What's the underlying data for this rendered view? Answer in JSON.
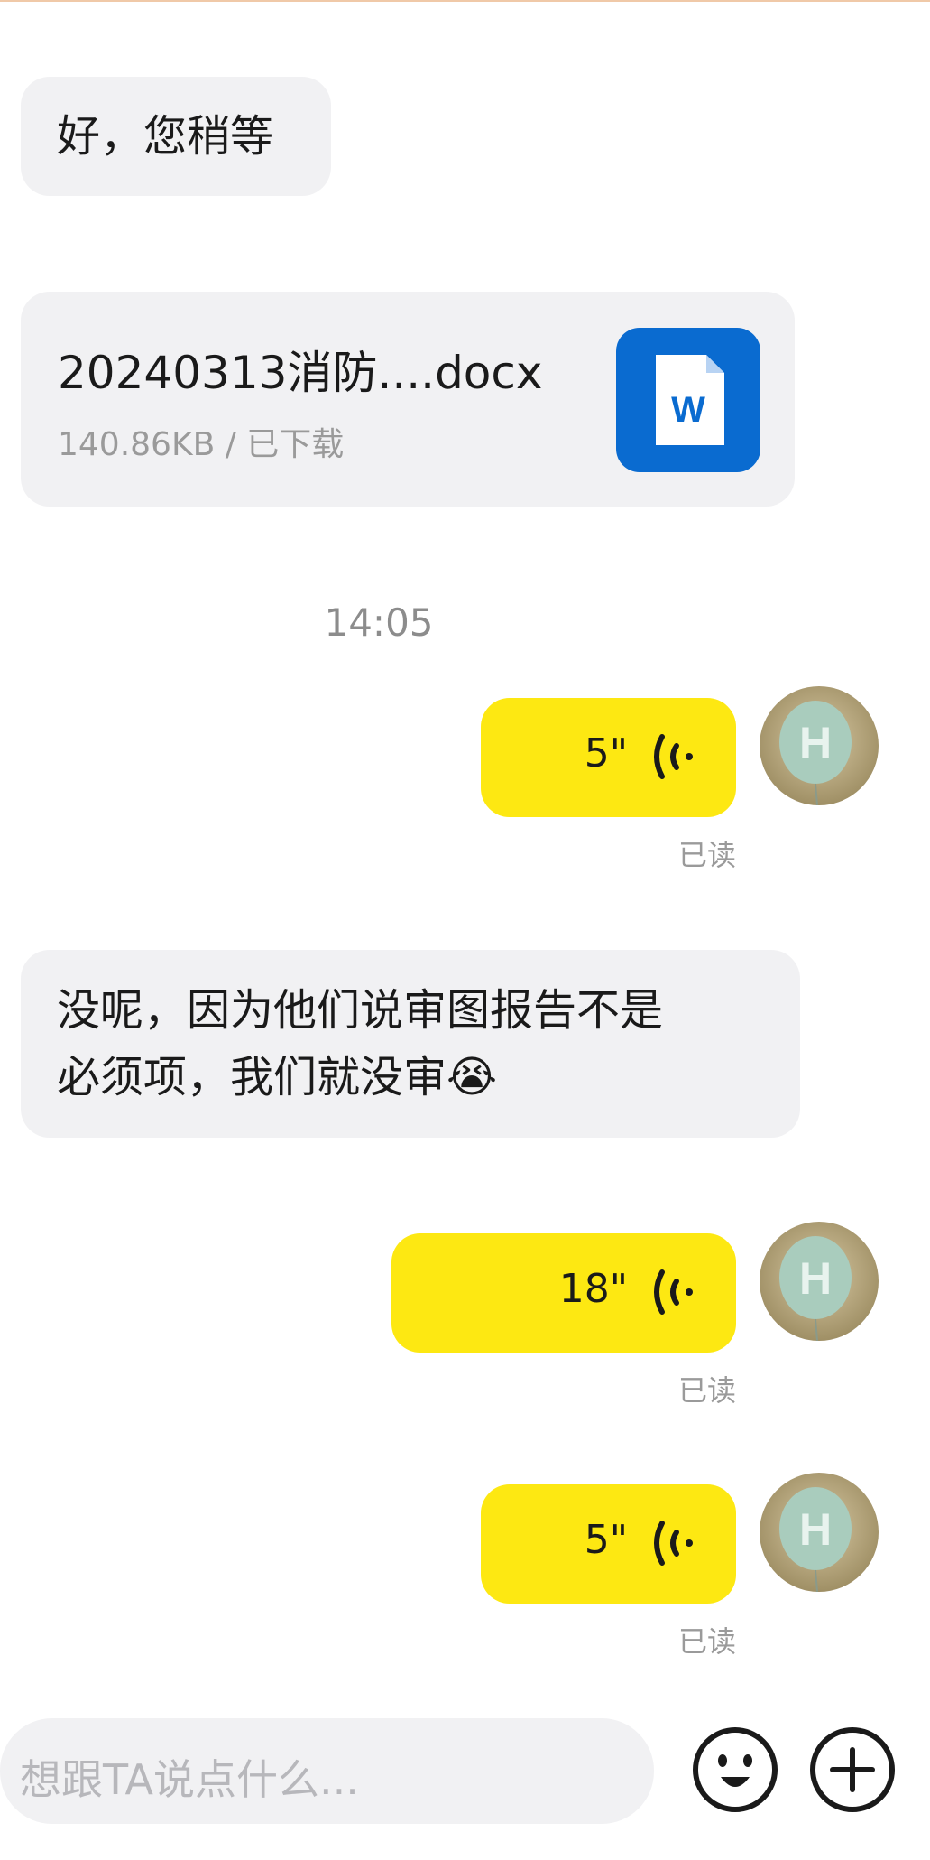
{
  "messages": [
    {
      "type": "text",
      "direction": "in",
      "text": "好，您稍等"
    },
    {
      "type": "file",
      "direction": "in",
      "file_name": "20240313消防....docx",
      "file_meta": "140.86KB / 已下载",
      "file_icon": "word-doc-icon"
    },
    {
      "type": "time",
      "text": "14:05"
    },
    {
      "type": "voice",
      "direction": "out",
      "duration": "5\"",
      "status": "已读"
    },
    {
      "type": "text",
      "direction": "in",
      "line1": "没呢，因为他们说审图报告不是",
      "line2": "必须项，我们就没审",
      "emoji": "😭"
    },
    {
      "type": "voice",
      "direction": "out",
      "duration": "18\"",
      "status": "已读"
    },
    {
      "type": "voice",
      "direction": "out",
      "duration": "5\"",
      "status": "已读"
    }
  ],
  "input": {
    "placeholder": "想跟TA说点什么..."
  },
  "colors": {
    "incoming_bubble": "#f1f1f3",
    "outgoing_bubble": "#fde812",
    "word_icon": "#0a6bd0"
  },
  "icons": {
    "emoji_button": "smiley-face-icon",
    "plus_button": "plus-circle-icon",
    "voice": "voice-wave-icon",
    "avatar": "balloon-avatar"
  }
}
